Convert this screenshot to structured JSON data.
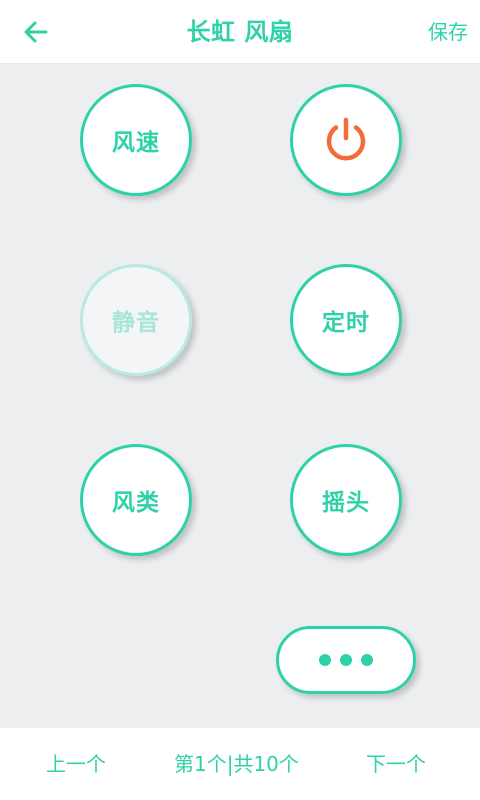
{
  "header": {
    "title": "长虹 风扇",
    "save_label": "保存",
    "back_icon": "arrow-left-icon"
  },
  "buttons": {
    "fan_speed": "风速",
    "power_icon": "power-icon",
    "mute": "静音",
    "timer": "定时",
    "wind_type": "风类",
    "swing": "摇头",
    "more_icon": "more-dots-icon"
  },
  "footer": {
    "prev_label": "上一个",
    "page_indicator": "第1个|共10个",
    "next_label": "下一个"
  },
  "colors": {
    "accent": "#2fd2a8",
    "power": "#f26b3a",
    "background": "#eceef0"
  }
}
